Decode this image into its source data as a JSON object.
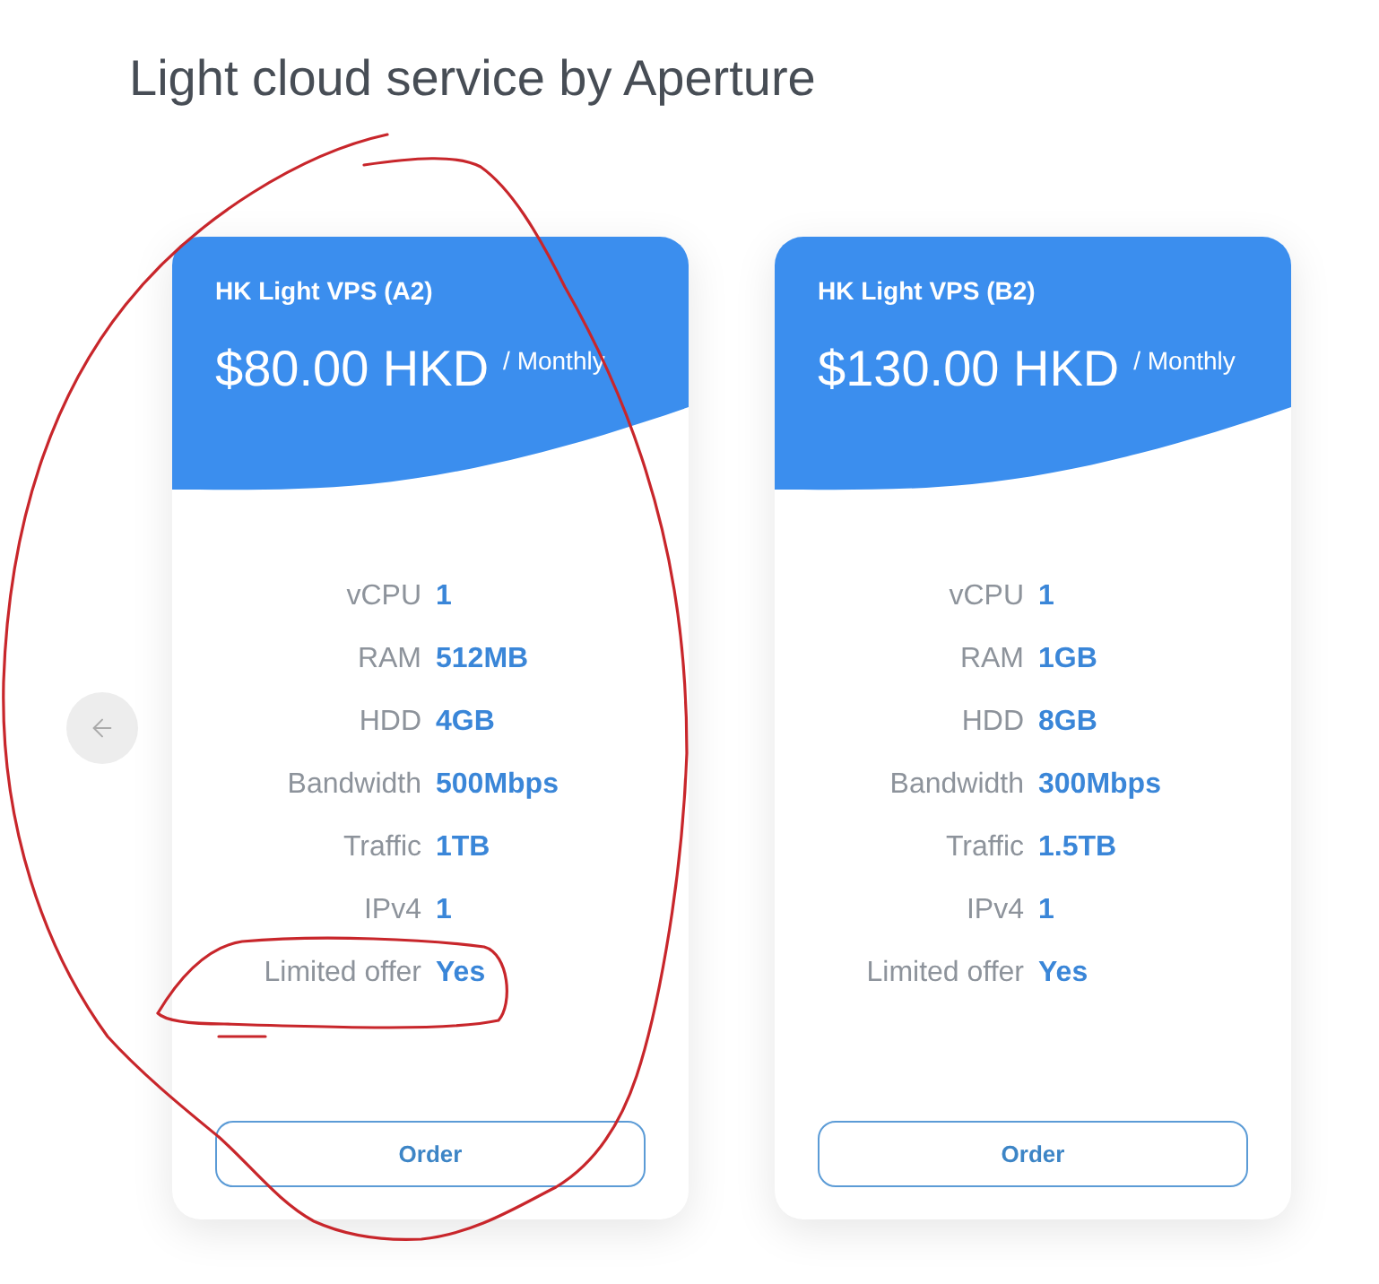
{
  "page": {
    "title": "Light cloud service by Aperture"
  },
  "plans": [
    {
      "name": "HK Light VPS (A2)",
      "price": "$80.00 HKD",
      "period": "/ Monthly",
      "specs": [
        {
          "label": "vCPU",
          "value": "1"
        },
        {
          "label": "RAM",
          "value": "512MB"
        },
        {
          "label": "HDD",
          "value": "4GB"
        },
        {
          "label": "Bandwidth",
          "value": "500Mbps"
        },
        {
          "label": "Traffic",
          "value": "1TB"
        },
        {
          "label": "IPv4",
          "value": "1"
        },
        {
          "label": "Limited offer",
          "value": "Yes"
        }
      ],
      "button": "Order"
    },
    {
      "name": "HK Light VPS (B2)",
      "price": "$130.00 HKD",
      "period": "/ Monthly",
      "specs": [
        {
          "label": "vCPU",
          "value": "1"
        },
        {
          "label": "RAM",
          "value": "1GB"
        },
        {
          "label": "HDD",
          "value": "8GB"
        },
        {
          "label": "Bandwidth",
          "value": "300Mbps"
        },
        {
          "label": "Traffic",
          "value": "1.5TB"
        },
        {
          "label": "IPv4",
          "value": "1"
        },
        {
          "label": "Limited offer",
          "value": "Yes"
        }
      ],
      "button": "Order"
    }
  ]
}
